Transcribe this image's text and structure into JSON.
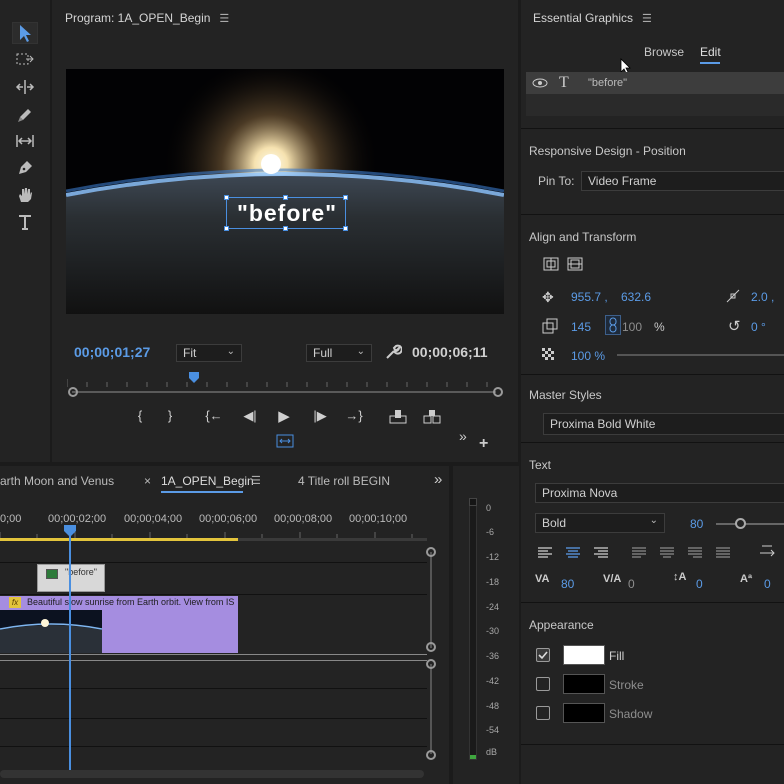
{
  "program": {
    "title": "Program: 1A_OPEN_Begin",
    "overlay_text": "\"before\"",
    "current_time": "00;00;01;27",
    "zoom": "Fit",
    "quality": "Full",
    "duration": "00;00;06;11"
  },
  "essential": {
    "title": "Essential Graphics",
    "tabs": [
      "Browse",
      "Edit"
    ],
    "active_tab": "Edit",
    "layer_name": "\"before\"",
    "responsive_title": "Responsive Design - Position",
    "pin_to_label": "Pin To:",
    "pin_to_value": "Video Frame",
    "align_title": "Align and Transform",
    "pos_x": "955.7 ,",
    "pos_y": "632.6",
    "anchor_value": "2.0 ,",
    "scale": "145",
    "scale_h": "100",
    "percent": "%",
    "rotation": "0 °",
    "opacity": "100 %",
    "master_title": "Master Styles",
    "master_value": "Proxima Bold White",
    "text_title": "Text",
    "font": "Proxima Nova",
    "font_style": "Bold",
    "font_size": "80",
    "kerning": "80",
    "tracking": "0",
    "leading": "0",
    "baseline": "0",
    "appearance_title": "Appearance",
    "fill_label": "Fill",
    "stroke_label": "Stroke",
    "shadow_label": "Shadow"
  },
  "timeline": {
    "tabs": [
      "arth Moon and Venus",
      "1A_OPEN_Begin",
      "4 Title roll BEGIN"
    ],
    "active_tab": "1A_OPEN_Begin",
    "ruler": [
      "0;00",
      "00;00;02;00",
      "00;00;04;00",
      "00;00;06;00",
      "00;00;08;00",
      "00;00;10;00"
    ],
    "title_clip": "\"before\"",
    "video_clip": "Beautiful slow sunrise from Earth orbit. View from IS",
    "fx": "fx"
  },
  "meter": {
    "scale": [
      "0",
      "-6",
      "-12",
      "-18",
      "-24",
      "-30",
      "-36",
      "-42",
      "-48",
      "-54",
      "dB"
    ]
  },
  "colors": {
    "accent": "#5b9be6",
    "panel": "#232323",
    "purple_clip": "#a58de0"
  }
}
